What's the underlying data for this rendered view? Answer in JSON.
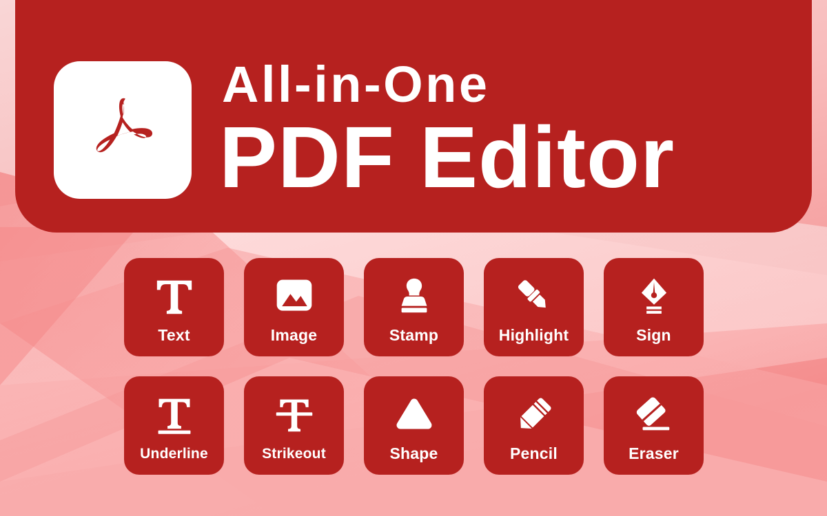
{
  "banner": {
    "logo_icon": "adobe-acrobat-logo",
    "headline_top": "All-in-One",
    "headline_main": "PDF Editor",
    "background_color": "#b6211f",
    "logo_tile_color": "#ffffff",
    "text_color": "#ffffff"
  },
  "page": {
    "background_base": "#f7c9c9",
    "accent_color": "#b6211f"
  },
  "tools": {
    "tile_color": "#b6211f",
    "label_color": "#ffffff",
    "items": [
      {
        "label": "Text",
        "icon": "text-serif-t-icon"
      },
      {
        "label": "Image",
        "icon": "image-picture-icon"
      },
      {
        "label": "Stamp",
        "icon": "stamp-icon"
      },
      {
        "label": "Highlight",
        "icon": "highlighter-marker-icon"
      },
      {
        "label": "Sign",
        "icon": "fountain-pen-nib-icon"
      },
      {
        "label": "Underline",
        "icon": "underline-t-icon"
      },
      {
        "label": "Strikeout",
        "icon": "strikethrough-t-icon"
      },
      {
        "label": "Shape",
        "icon": "triangle-shape-icon"
      },
      {
        "label": "Pencil",
        "icon": "pencil-icon"
      },
      {
        "label": "Eraser",
        "icon": "eraser-icon"
      }
    ]
  }
}
